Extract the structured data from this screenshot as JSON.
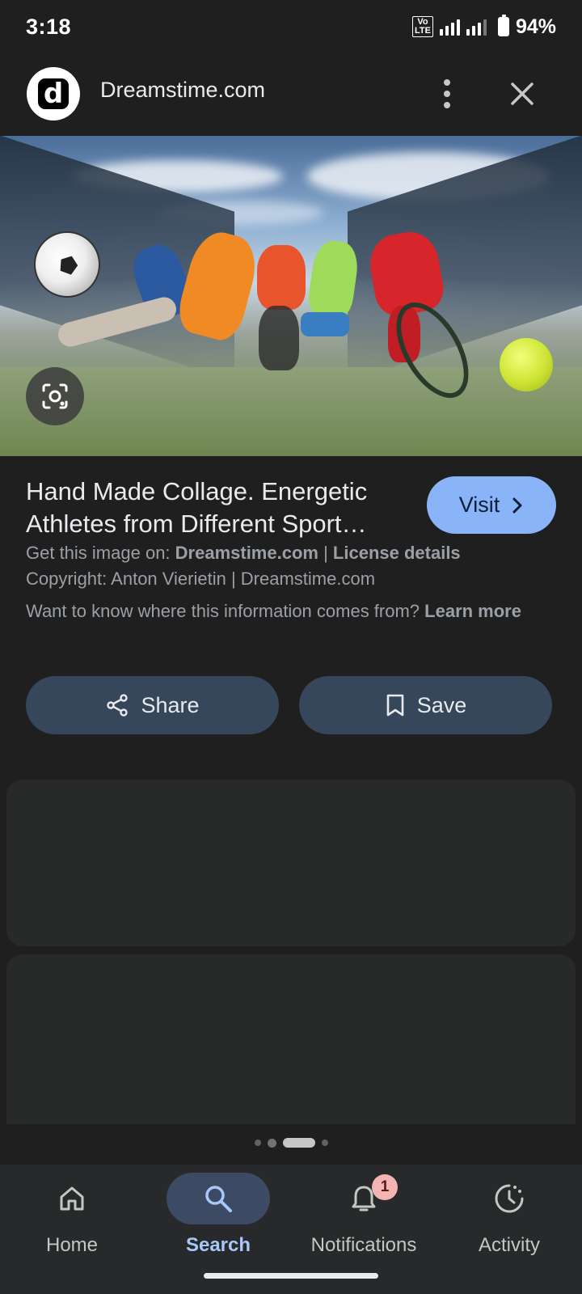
{
  "status_bar": {
    "time": "3:18",
    "network": "4G",
    "volte": "VoLTE 2",
    "battery": "94%"
  },
  "header": {
    "logo_letter": "d",
    "site_name": "Dreamstime.com",
    "more_icon": "more-vert-icon",
    "close_icon": "close-icon"
  },
  "hero": {
    "lens_icon": "lens-icon"
  },
  "info": {
    "title_line1": "Hand Made Collage. Energetic",
    "title_line2": "Athletes from Different Sport…",
    "visit_label": "Visit",
    "get_image_prefix": "Get this image on: ",
    "get_image_site": "Dreamstime.com",
    "separator": " | ",
    "license_label": "License details",
    "copyright": "Copyright: Anton Vierietin | Dreamstime.com",
    "info_question": "Want to know where this information comes from? ",
    "learn_more": "Learn more"
  },
  "actions": {
    "share_label": "Share",
    "save_label": "Save"
  },
  "bottom_nav": {
    "items": [
      {
        "label": "Home",
        "icon": "home-icon"
      },
      {
        "label": "Search",
        "icon": "search-icon"
      },
      {
        "label": "Notifications",
        "icon": "bell-icon",
        "badge": "1"
      },
      {
        "label": "Activity",
        "icon": "activity-icon"
      }
    ],
    "active_index": 1
  },
  "colors": {
    "background": "#1f1f1f",
    "accent": "#8ab4f8",
    "pill_button": "#36465b",
    "nav_active": "#a8c7fa"
  }
}
